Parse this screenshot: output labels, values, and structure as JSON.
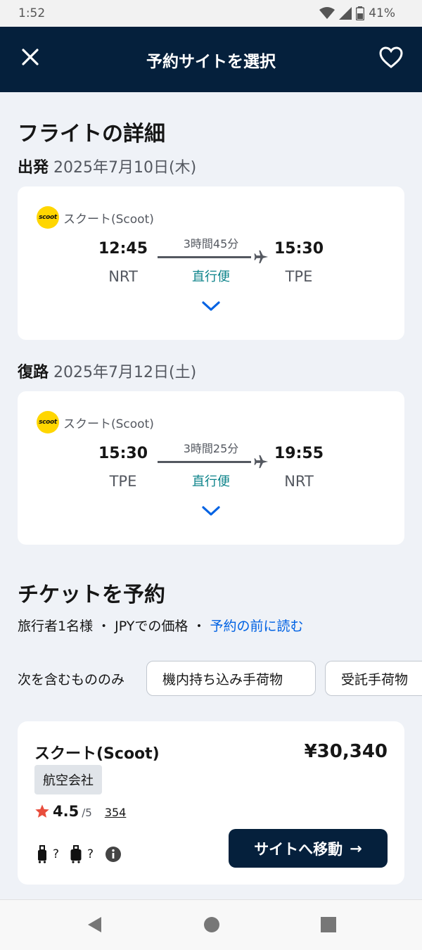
{
  "status": {
    "time": "1:52",
    "battery": "41%"
  },
  "header": {
    "title": "予約サイトを選択",
    "close_icon": "close-icon",
    "favorite_icon": "heart-icon"
  },
  "details": {
    "heading": "フライトの詳細",
    "outbound": {
      "label": "出発",
      "date": "2025年7月10日(木)",
      "logo_text": "scoot",
      "airline": "スクート(Scoot)",
      "dep_time": "12:45",
      "dep_code": "NRT",
      "duration": "3時間45分",
      "stops": "直行便",
      "arr_time": "15:30",
      "arr_code": "TPE"
    },
    "inbound": {
      "label": "復路",
      "date": "2025年7月12日(土)",
      "logo_text": "scoot",
      "airline": "スクート(Scoot)",
      "dep_time": "15:30",
      "dep_code": "TPE",
      "duration": "3時間25分",
      "stops": "直行便",
      "arr_time": "19:55",
      "arr_code": "NRT"
    }
  },
  "booking": {
    "heading": "チケットを予約",
    "pax_info": "旅行者1名様 ・ JPYでの価格 ・ ",
    "read_link": "予約の前に読む",
    "filter_label": "次を含むもののみ",
    "chips": [
      "機内持ち込み手荷物",
      "受託手荷物"
    ]
  },
  "offer": {
    "name": "スクート(Scoot)",
    "price": "¥30,340",
    "badge": "航空会社",
    "rating": "4.5",
    "rating_max": "/5",
    "review_count": "354",
    "bag_unknown": "?",
    "button_label": "サイトへ移動",
    "button_arrow": "→"
  },
  "colors": {
    "navy": "#05203c",
    "teal": "#0c838a",
    "link": "#0062e3",
    "star": "#e84d3c",
    "logo_yellow": "#ffd600"
  }
}
